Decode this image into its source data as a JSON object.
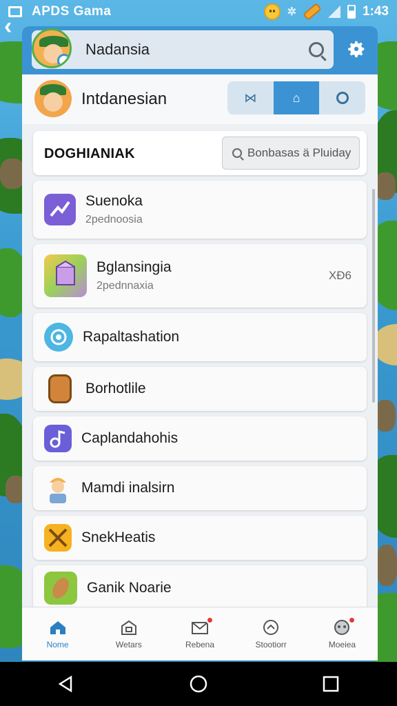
{
  "status_bar": {
    "app_title": "APDS Gama",
    "time": "1:43"
  },
  "header": {
    "search_label": "Nadansia"
  },
  "profile": {
    "name": "Intdanesian"
  },
  "section": {
    "title": "DOGHIANIAK",
    "search_placeholder": "Bonbasas ä Pluiday"
  },
  "items": [
    {
      "title": "Suenoka",
      "subtitle": "2pednoosia",
      "icon": "chart-icon",
      "color": "#7b5fd6"
    },
    {
      "title": "Bglansingia",
      "subtitle": "2pednnaxia",
      "meta": "XĐ6",
      "icon": "puzzle-cube-icon",
      "color": "#f2c94c"
    },
    {
      "title": "Rapaltashation",
      "icon": "at-sign-icon",
      "color": "#4db6e2"
    },
    {
      "title": "Borhotlile",
      "icon": "backpack-icon",
      "color": "#d2843a"
    },
    {
      "title": "Caplandahohis",
      "icon": "music-note-icon",
      "color": "#6a5fd6"
    },
    {
      "title": "Mamdi inalsirn",
      "icon": "worker-icon",
      "color": "#f4b04e"
    },
    {
      "title": "SnekHeatis",
      "icon": "crossed-tools-icon",
      "color": "#f6b21f"
    },
    {
      "title": "Ganik Noarie",
      "icon": "bread-icon",
      "color": "#8dc63f"
    }
  ],
  "bottom_nav": [
    {
      "label": "Nome",
      "icon": "home-icon",
      "active": true,
      "badge": false
    },
    {
      "label": "Wetars",
      "icon": "store-icon",
      "active": false,
      "badge": false
    },
    {
      "label": "Rebena",
      "icon": "mail-icon",
      "active": false,
      "badge": true
    },
    {
      "label": "Stootiorr",
      "icon": "compass-icon",
      "active": false,
      "badge": false
    },
    {
      "label": "Moeiea",
      "icon": "gamepad-icon",
      "active": false,
      "badge": true
    }
  ],
  "colors": {
    "accent": "#3b93d3",
    "badge": "#e53935"
  }
}
